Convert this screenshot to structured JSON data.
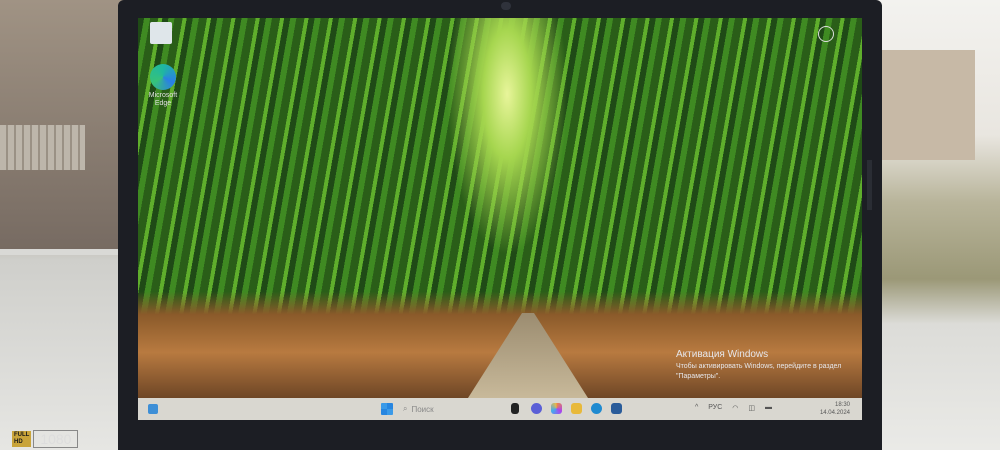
{
  "desktop": {
    "icons": [
      {
        "name": "recycle-bin",
        "label": ""
      },
      {
        "name": "microsoft-edge",
        "label": "Microsoft Edge"
      }
    ]
  },
  "activation": {
    "title": "Активация Windows",
    "subtitle": "Чтобы активировать Windows, перейдите в раздел \"Параметры\"."
  },
  "taskbar": {
    "search_placeholder": "Поиск",
    "language": "РУС",
    "time": "18:30",
    "date": "14.04.2024"
  },
  "laptop": {
    "badge_top": "FULL",
    "badge_bottom": "HD",
    "resolution": "1080"
  }
}
